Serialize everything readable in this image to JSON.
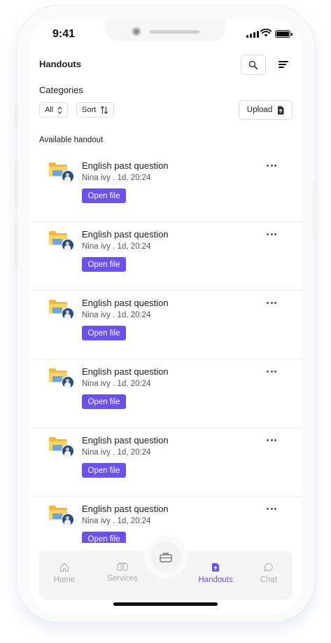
{
  "status_bar": {
    "time": "9:41"
  },
  "header": {
    "title": "Handouts",
    "search_icon": "search-icon",
    "menu_icon": "menu-lines-icon"
  },
  "filters": {
    "categories_label": "Categories",
    "all_label": "All",
    "sort_label": "Sort",
    "upload_label": "Upload"
  },
  "section_title": "Available handout",
  "handouts": [
    {
      "title": "English past question",
      "meta": "Nina ivy . 1d, 20:24",
      "action": "Open file"
    },
    {
      "title": "English past question",
      "meta": "Nina ivy . 1d, 20:24",
      "action": "Open file"
    },
    {
      "title": "English past question",
      "meta": "Nina ivy . 1d, 20:24",
      "action": "Open file"
    },
    {
      "title": "English past question",
      "meta": "Nina ivy . 1d, 20:24",
      "action": "Open file"
    },
    {
      "title": "English past question",
      "meta": "Nina ivy . 1d, 20:24",
      "action": "Open file"
    },
    {
      "title": "English past question",
      "meta": "Nina ivy . 1d, 20:24",
      "action": "Open file"
    }
  ],
  "bottom_nav": {
    "items": [
      {
        "label": "Home",
        "icon": "home-icon",
        "active": false
      },
      {
        "label": "Services",
        "icon": "money-icon",
        "active": false
      },
      {
        "label": "Handouts",
        "icon": "handout-icon",
        "active": true
      },
      {
        "label": "Chat",
        "icon": "chat-bubble-icon",
        "active": false
      }
    ],
    "center_icon": "briefcase-icon"
  },
  "colors": {
    "accent": "#6b4ff7",
    "text": "#222222",
    "muted": "#aaaaaa"
  }
}
